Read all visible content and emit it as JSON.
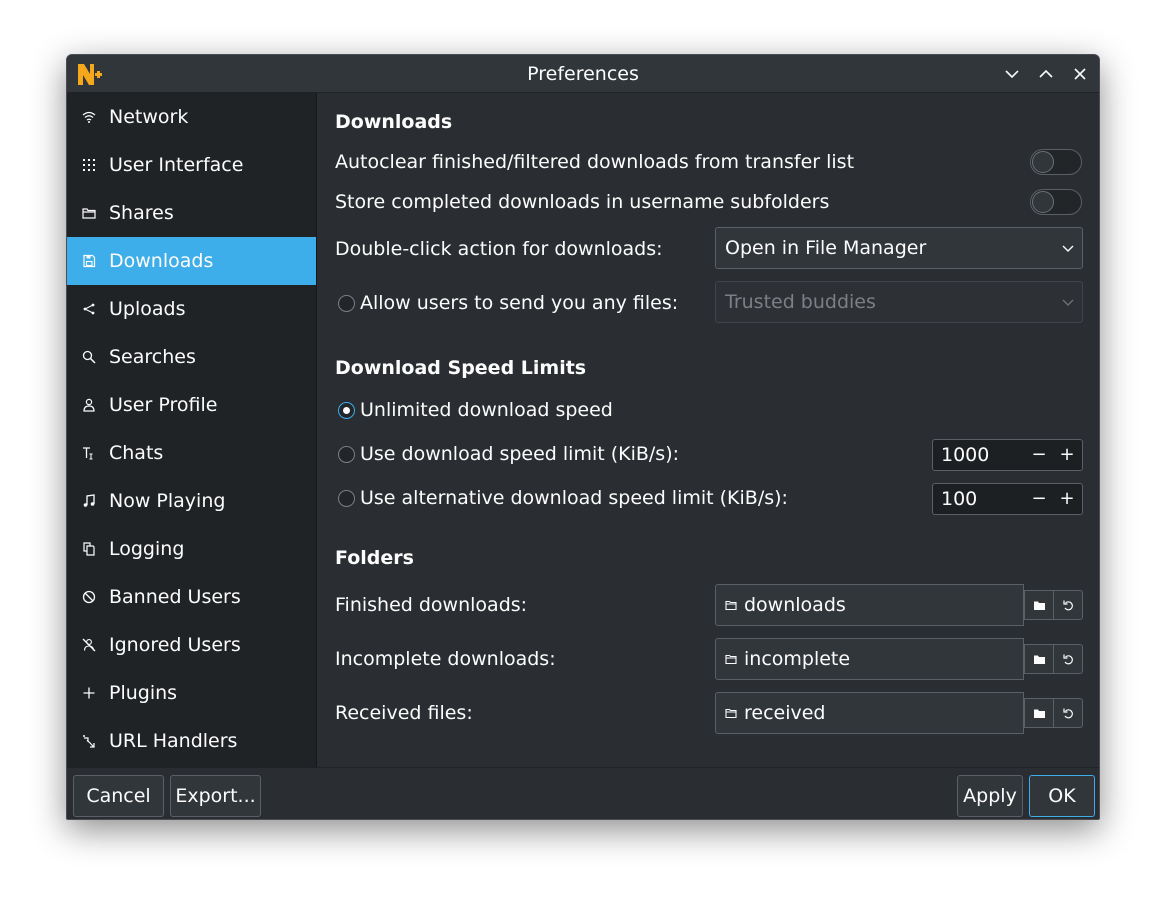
{
  "window": {
    "title": "Preferences"
  },
  "colors": {
    "accent": "#3daee9",
    "logo": "#f6a81c",
    "background": "#2a2e32",
    "sidebar": "#202326"
  },
  "sidebar": {
    "items": [
      {
        "label": "Network",
        "icon": "wifi-icon"
      },
      {
        "label": "User Interface",
        "icon": "grid-dots-icon"
      },
      {
        "label": "Shares",
        "icon": "folder-icon"
      },
      {
        "label": "Downloads",
        "icon": "floppy-icon",
        "active": true
      },
      {
        "label": "Uploads",
        "icon": "share-icon"
      },
      {
        "label": "Searches",
        "icon": "search-icon"
      },
      {
        "label": "User Profile",
        "icon": "user-icon"
      },
      {
        "label": "Chats",
        "icon": "text-cursor-icon"
      },
      {
        "label": "Now Playing",
        "icon": "music-note-icon"
      },
      {
        "label": "Logging",
        "icon": "copy-document-icon"
      },
      {
        "label": "Banned Users",
        "icon": "block-icon"
      },
      {
        "label": "Ignored Users",
        "icon": "muted-user-icon"
      },
      {
        "label": "Plugins",
        "icon": "plus-icon"
      },
      {
        "label": "URL Handlers",
        "icon": "link-icon"
      }
    ]
  },
  "downloads": {
    "section_title": "Downloads",
    "autoclear_label": "Autoclear finished/filtered downloads from transfer list",
    "autoclear_on": false,
    "subfolders_label": "Store completed downloads in username subfolders",
    "subfolders_on": false,
    "double_click_label": "Double-click action for downloads:",
    "double_click_value": "Open in File Manager",
    "allow_users_label": "Allow users to send you any files:",
    "allow_users_value": "Trusted buddies"
  },
  "speed": {
    "section_title": "Download Speed Limits",
    "unlimited_label": "Unlimited download speed",
    "limit_label": "Use download speed limit (KiB/s):",
    "limit_value": "1000",
    "alt_limit_label": "Use alternative download speed limit (KiB/s):",
    "alt_limit_value": "100",
    "minus": "−",
    "plus": "+"
  },
  "folders": {
    "section_title": "Folders",
    "finished_label": "Finished downloads:",
    "finished_value": "downloads",
    "incomplete_label": "Incomplete downloads:",
    "incomplete_value": "incomplete",
    "received_label": "Received files:",
    "received_value": "received"
  },
  "footer": {
    "cancel": "Cancel",
    "export": "Export...",
    "apply": "Apply",
    "ok": "OK"
  }
}
